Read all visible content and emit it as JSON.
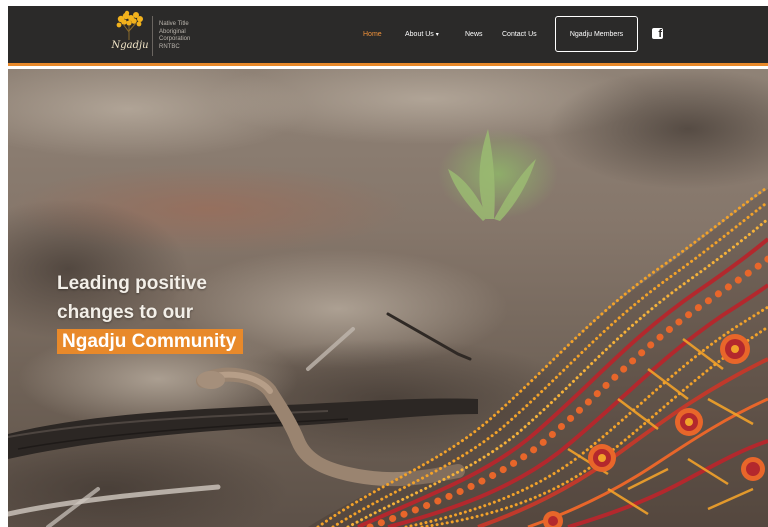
{
  "brand": {
    "logo_script": "Ngadju",
    "logo_lines": [
      "Native Title",
      "Aboriginal",
      "Corporation",
      "RNTBC"
    ]
  },
  "nav": {
    "items": [
      {
        "label": "Home",
        "active": true
      },
      {
        "label": "About Us",
        "has_dropdown": true
      },
      {
        "label": "News"
      },
      {
        "label": "Contact Us"
      }
    ],
    "members_button": "Ngadju Members",
    "social_icon": "facebook-icon"
  },
  "hero": {
    "headline_line1": "Leading positive",
    "headline_line2": "changes to our",
    "headline_highlight": "Ngadju Community"
  },
  "colors": {
    "header_bg": "#2b2a29",
    "accent": "#e8892a",
    "art_red": "#b3282d",
    "art_orange": "#e8662a",
    "art_yellow": "#f2a22a"
  }
}
